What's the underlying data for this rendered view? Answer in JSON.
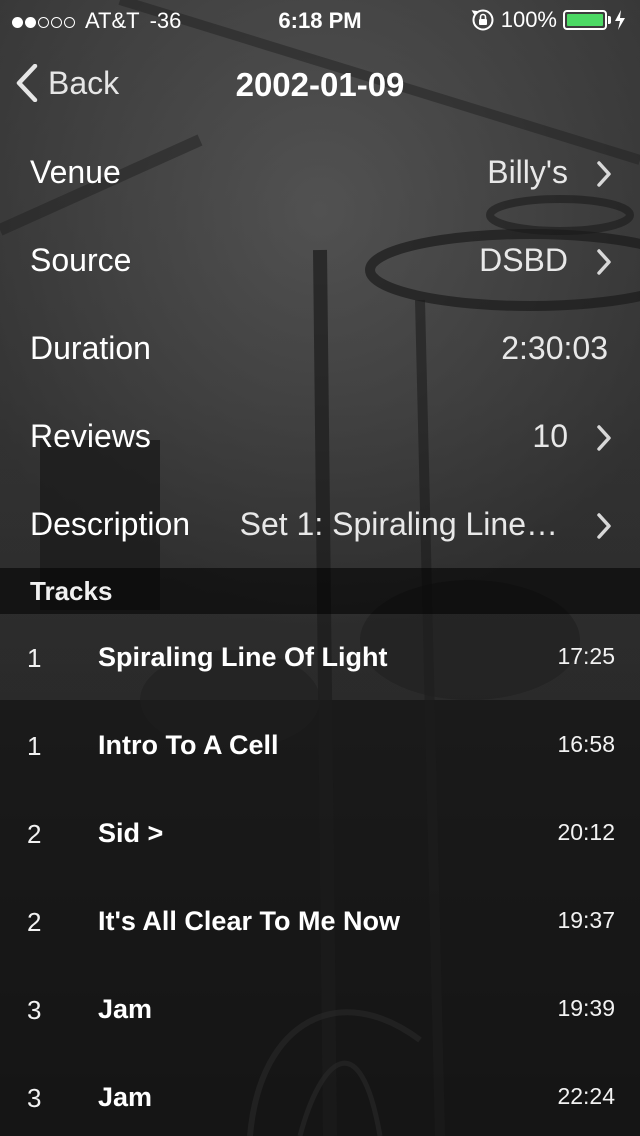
{
  "status_bar": {
    "signal_dots": [
      true,
      true,
      false,
      false,
      false
    ],
    "carrier": "AT&T",
    "signal_strength": "-36",
    "time": "6:18 PM",
    "battery_percent": "100%",
    "battery_level": 1.0,
    "battery_color": "#4cd964",
    "icons": [
      "rotation-lock-icon",
      "battery-icon",
      "charging-bolt-icon"
    ]
  },
  "nav": {
    "back_label": "Back",
    "back_icon": "chevron-left-icon",
    "title": "2002-01-09"
  },
  "details": [
    {
      "label": "Venue",
      "value": "Billy's",
      "has_chevron": true
    },
    {
      "label": "Source",
      "value": "DSBD",
      "has_chevron": true
    },
    {
      "label": "Duration",
      "value": "2:30:03",
      "has_chevron": false
    },
    {
      "label": "Reviews",
      "value": "10",
      "has_chevron": true
    },
    {
      "label": "Description",
      "value": "Set 1: Spiraling Line…",
      "has_chevron": true
    }
  ],
  "tracks_section": {
    "header": "Tracks",
    "items": [
      {
        "set": "1",
        "title": "Spiraling Line Of Light",
        "duration": "17:25"
      },
      {
        "set": "1",
        "title": "Intro To A Cell",
        "duration": "16:58"
      },
      {
        "set": "2",
        "title": "Sid >",
        "duration": "20:12"
      },
      {
        "set": "2",
        "title": "It's All Clear To Me Now",
        "duration": "19:37"
      },
      {
        "set": "3",
        "title": "Jam",
        "duration": "19:39"
      },
      {
        "set": "3",
        "title": "Jam",
        "duration": "22:24"
      }
    ]
  }
}
